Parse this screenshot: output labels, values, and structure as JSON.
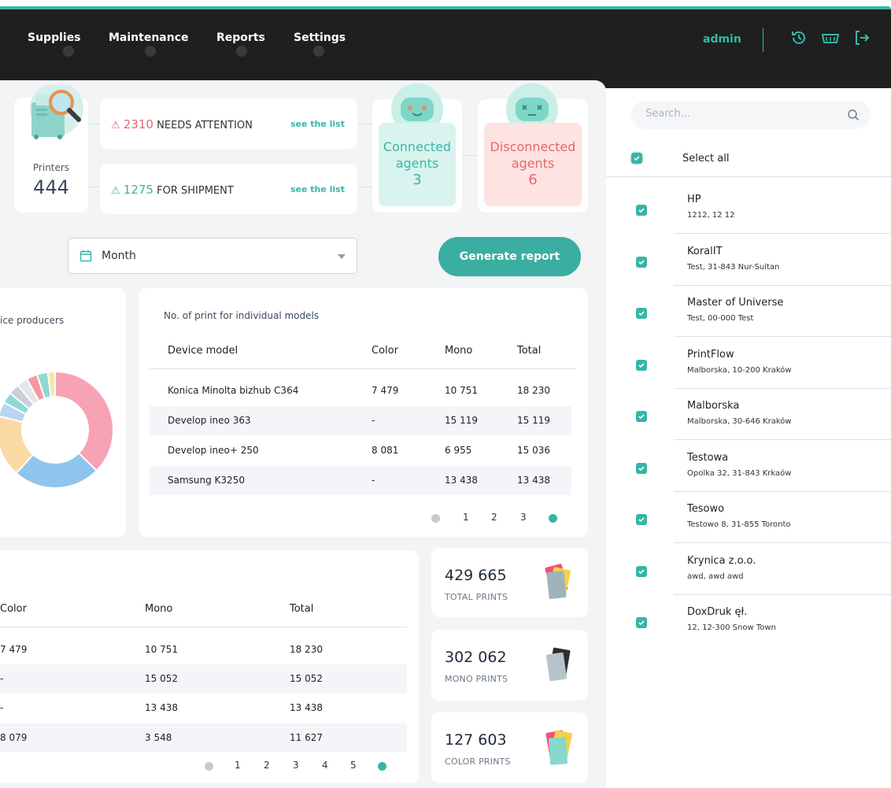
{
  "nav": {
    "items": [
      "Supplies",
      "Maintenance",
      "Reports",
      "Settings"
    ],
    "user": "admin",
    "icons": [
      "history-icon",
      "basket-icon",
      "logout-icon"
    ]
  },
  "summary": {
    "printers_label": "Printers",
    "printers_value": "444",
    "attention_count": "2310",
    "attention_label": "NEEDS ATTENTION",
    "shipment_count": "1275",
    "shipment_label": "FOR SHIPMENT",
    "see_list": "see the list",
    "connected_label_1": "Connected",
    "connected_label_2": "agents",
    "connected_value": "3",
    "disconnected_label_1": "Disconnected",
    "disconnected_label_2": "agents",
    "disconnected_value": "6"
  },
  "period": {
    "selected": "Month"
  },
  "generate_button": "Generate report",
  "producers": {
    "title": "ice producers",
    "slices": [
      {
        "value": 37,
        "color": "#f7a3b5"
      },
      {
        "value": 24,
        "color": "#8ec5ee"
      },
      {
        "value": 17,
        "color": "#fbd9a4"
      },
      {
        "value": 4,
        "color": "#b9d5f1"
      },
      {
        "value": 3,
        "color": "#90d9d6"
      },
      {
        "value": 3,
        "color": "#c8d0d8"
      },
      {
        "value": 3,
        "color": "#e3e6ea"
      },
      {
        "value": 3,
        "color": "#f39aa0"
      },
      {
        "value": 3,
        "color": "#8fd8d3"
      },
      {
        "value": 2,
        "color": "#f8e7a8"
      }
    ]
  },
  "models": {
    "title": "No. of print for individual models",
    "headers": [
      "Device model",
      "Color",
      "Mono",
      "Total"
    ],
    "rows": [
      [
        "Konica Minolta bizhub C364",
        "7 479",
        "10 751",
        "18 230"
      ],
      [
        "Develop ineo 363",
        "-",
        "15 119",
        "15 119"
      ],
      [
        "Develop ineo+ 250",
        "8 081",
        "6 955",
        "15 036"
      ],
      [
        "Samsung K3250",
        "-",
        "13 438",
        "13 438"
      ]
    ],
    "pages": [
      "1",
      "2",
      "3"
    ]
  },
  "bottom_table": {
    "headers": [
      "Color",
      "Mono",
      "Total"
    ],
    "rows": [
      [
        "7 479",
        "10 751",
        "18 230"
      ],
      [
        "-",
        "15 052",
        "15 052"
      ],
      [
        "-",
        "13 438",
        "13 438"
      ],
      [
        "8 079",
        "3 548",
        "11 627"
      ]
    ],
    "pages": [
      "1",
      "2",
      "3",
      "4",
      "5"
    ]
  },
  "stats": [
    {
      "value": "429 665",
      "label": "TOTAL PRINTS"
    },
    {
      "value": "302 062",
      "label": "MONO PRINTS"
    },
    {
      "value": "127 603",
      "label": "COLOR PRINTS"
    }
  ],
  "sidebar": {
    "search_placeholder": "Search...",
    "select_all": "Select all",
    "clients": [
      {
        "name": "HP",
        "address": "1212, 12 12"
      },
      {
        "name": "KoralIT",
        "address": "Test, 31-843 Nur-Sultan"
      },
      {
        "name": "Master of Universe",
        "address": "Test, 00-000 Test"
      },
      {
        "name": "PrintFlow",
        "address": "Malborska, 10-200 Kraków"
      },
      {
        "name": "Malborska",
        "address": "Malborska, 30-646 Kraków"
      },
      {
        "name": "Testowa",
        "address": "Opolka 32, 31-843 Krkaów"
      },
      {
        "name": "Tesowo",
        "address": "Testowo 8, 31-855 Toronto"
      },
      {
        "name": "Krynica z.o.o.",
        "address": "awd, awd awd"
      },
      {
        "name": "DoxDruk ęł.",
        "address": "12, 12-300 Snow Town"
      }
    ]
  },
  "colors": {
    "accent": "#37b6a6",
    "alert_red": "#e8666b",
    "navbar": "#1f1f1f",
    "connected_bg": "#d9f4ee",
    "disconnected_bg": "#fde3e1"
  }
}
